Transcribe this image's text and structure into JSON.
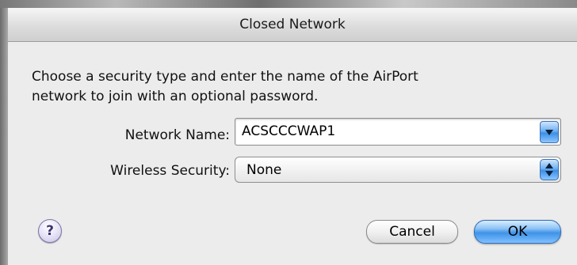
{
  "dialog": {
    "title": "Closed Network",
    "description_line1": "Choose a security type and enter the name of the AirPort",
    "description_line2": "network to join with an optional password."
  },
  "fields": {
    "network_name_label": "Network Name:",
    "network_name_value": "ACSCCCWAP1",
    "wireless_security_label": "Wireless Security:",
    "wireless_security_value": "None"
  },
  "buttons": {
    "help": "?",
    "cancel": "Cancel",
    "ok": "OK"
  },
  "colors": {
    "accent": "#3f93e8",
    "window_bg": "#ececec"
  }
}
